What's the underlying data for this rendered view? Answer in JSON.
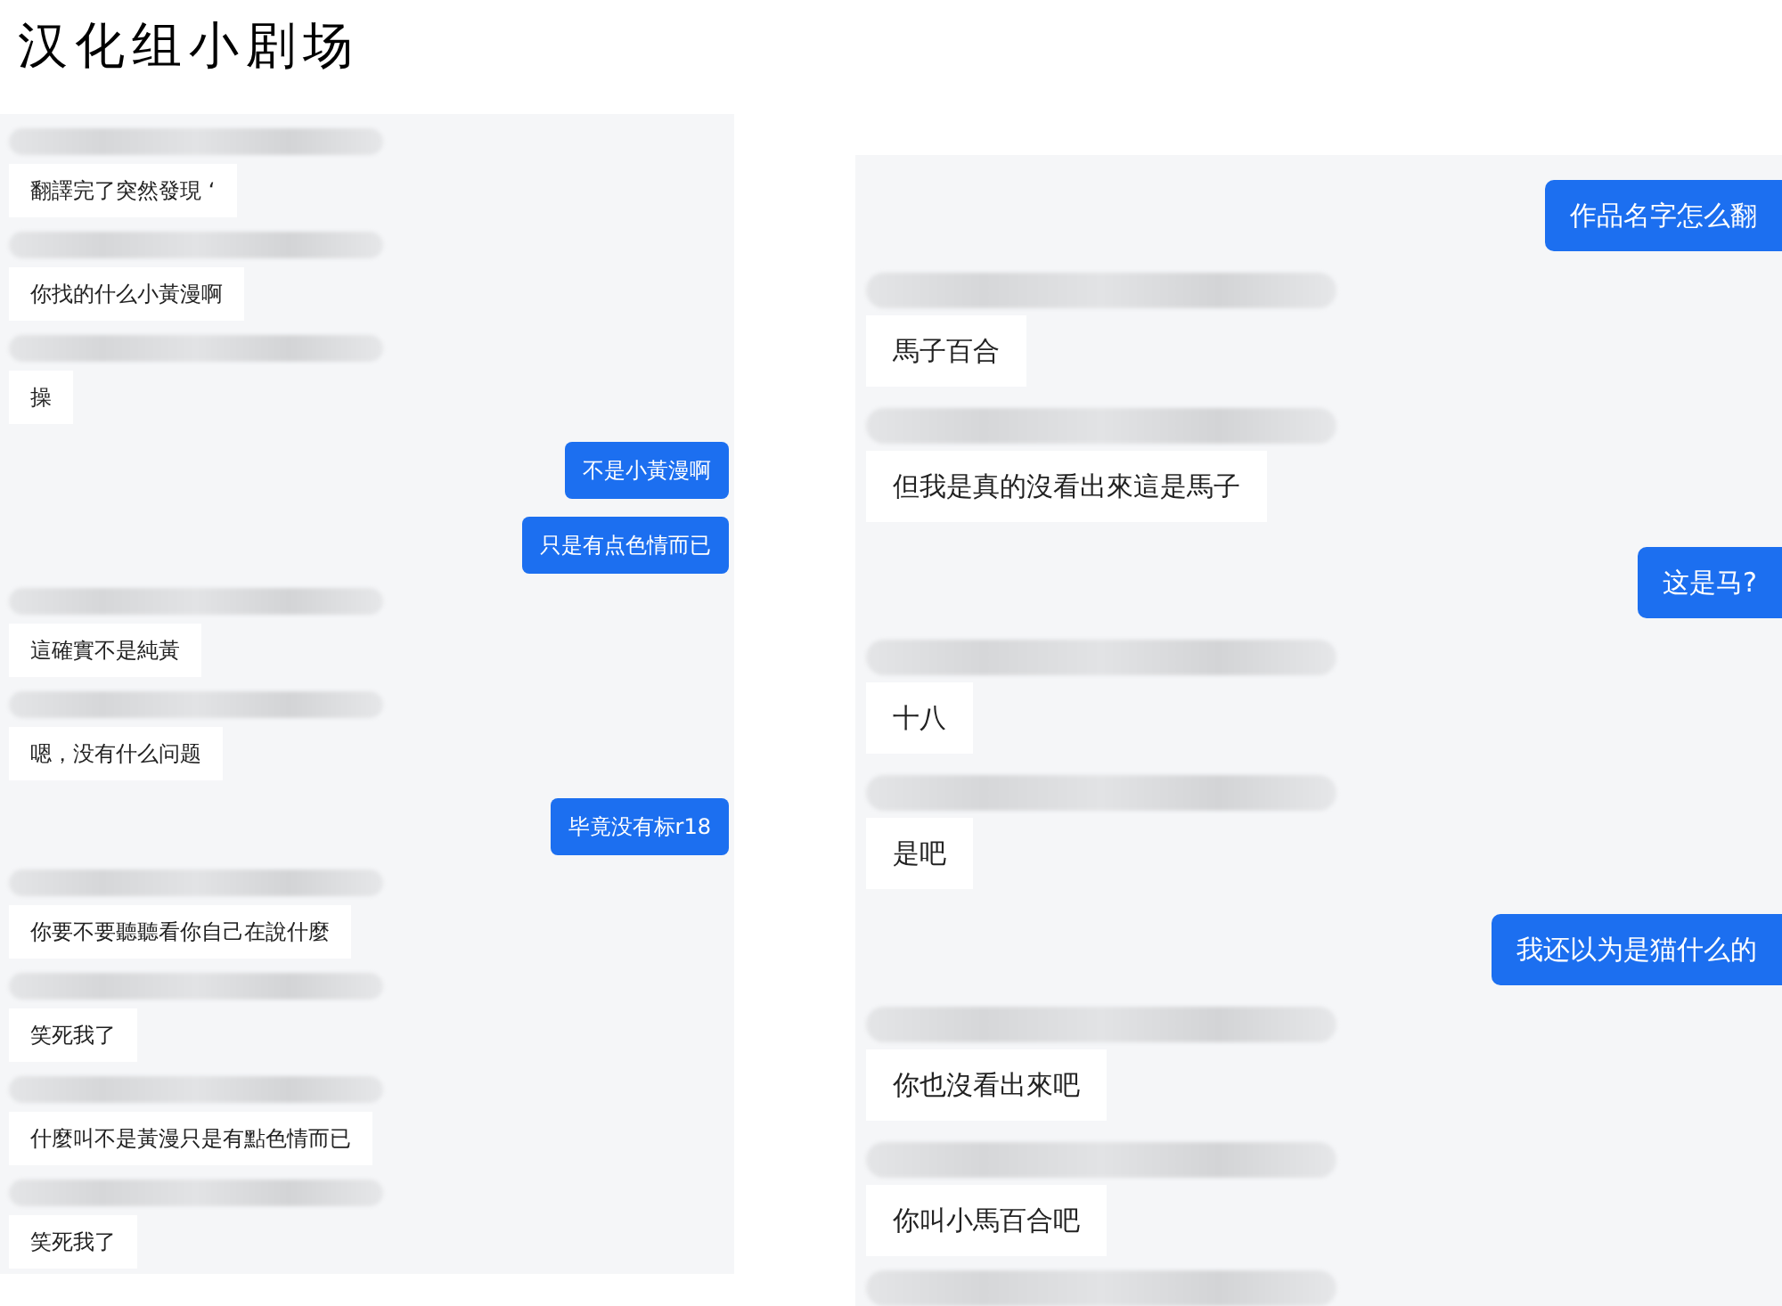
{
  "title": "汉化组小剧场",
  "left_chat": {
    "messages": [
      {
        "kind": "received",
        "text": "翻譯完了突然發現 ‘"
      },
      {
        "kind": "received",
        "text": "你找的什么小黃漫啊"
      },
      {
        "kind": "received",
        "text": "操"
      },
      {
        "kind": "sent",
        "text": "不是小黃漫啊"
      },
      {
        "kind": "sent",
        "text": "只是有点色情而已"
      },
      {
        "kind": "received",
        "text": "這確實不是純黃"
      },
      {
        "kind": "received",
        "text": "嗯，没有什么问题"
      },
      {
        "kind": "sent",
        "text": "毕竟没有标r18"
      },
      {
        "kind": "received",
        "text": "你要不要聽聽看你自己在說什麼"
      },
      {
        "kind": "received",
        "text": "笑死我了"
      },
      {
        "kind": "received",
        "text": "什麼叫不是黃漫只是有點色情而已"
      },
      {
        "kind": "received",
        "text": "笑死我了"
      }
    ]
  },
  "right_chat": {
    "messages": [
      {
        "kind": "sent",
        "text": "作品名字怎么翻"
      },
      {
        "kind": "received",
        "text": "馬子百合"
      },
      {
        "kind": "received",
        "text": "但我是真的沒看出來這是馬子"
      },
      {
        "kind": "sent",
        "text": "这是马?"
      },
      {
        "kind": "received",
        "text": "十八"
      },
      {
        "kind": "received",
        "text": "是吧"
      },
      {
        "kind": "sent",
        "text": "我还以为是猫什么的"
      },
      {
        "kind": "received",
        "text": "你也沒看出來吧"
      },
      {
        "kind": "received",
        "text": "你叫小馬百合吧"
      }
    ]
  }
}
